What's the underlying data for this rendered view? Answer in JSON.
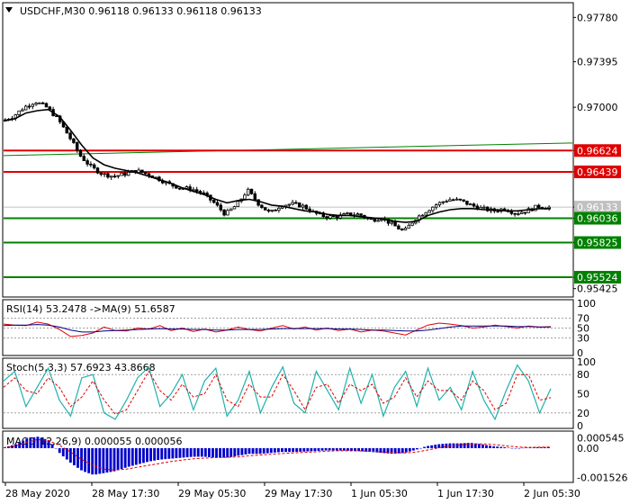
{
  "chart_data": {
    "type": "candlestick",
    "main": {
      "title": "USDCHF,M30  0.96118 0.96133 0.96118 0.96133",
      "ylim": [
        0.9536,
        0.979
      ],
      "y_ticks": [
        0.9778,
        0.97395,
        0.97,
        0.96624,
        0.96439,
        0.96133,
        0.96036,
        0.95825,
        0.95524,
        0.95425
      ],
      "x_labels": [
        "28 May 2020",
        "28 May 17:30",
        "29 May 05:30",
        "29 May 17:30",
        "1 Jun 05:30",
        "1 Jun 17:30",
        "2 Jun 05:30"
      ],
      "current_price": 0.96133,
      "levels": [
        {
          "value": 0.96624,
          "label": "0.96624",
          "color": "#e00000"
        },
        {
          "value": 0.96439,
          "label": "0.96439",
          "color": "#e00000"
        },
        {
          "value": 0.96036,
          "label": "0.96036",
          "color": "#008000"
        },
        {
          "value": 0.95825,
          "label": "0.95825",
          "color": "#008000"
        },
        {
          "value": 0.95524,
          "label": "0.95524",
          "color": "#008000"
        }
      ],
      "trendline": {
        "from": [
          0,
          0.9658
        ],
        "to": [
          156,
          0.9669
        ],
        "color": "#008000"
      },
      "price_path": [
        0.9688,
        0.9692,
        0.97,
        0.9705,
        0.97,
        0.969,
        0.9675,
        0.9658,
        0.9648,
        0.9642,
        0.964,
        0.9642,
        0.9645,
        0.9642,
        0.9638,
        0.9633,
        0.963,
        0.9629,
        0.9625,
        0.9617,
        0.9607,
        0.9615,
        0.9628,
        0.9616,
        0.9608,
        0.9615,
        0.9616,
        0.9614,
        0.9608,
        0.9605,
        0.9605,
        0.9607,
        0.9607,
        0.9602,
        0.9604,
        0.9598,
        0.9592,
        0.9603,
        0.961,
        0.9616,
        0.962,
        0.9619,
        0.9615,
        0.9612,
        0.961,
        0.9612,
        0.9608,
        0.961,
        0.9614,
        0.9613
      ],
      "ma_path": [
        0.9688,
        0.969,
        0.9695,
        0.9697,
        0.9698,
        0.9692,
        0.968,
        0.9667,
        0.9656,
        0.965,
        0.9647,
        0.9645,
        0.9643,
        0.964,
        0.9637,
        0.9634,
        0.963,
        0.9627,
        0.9624,
        0.962,
        0.9617,
        0.9619,
        0.962,
        0.9618,
        0.9615,
        0.9614,
        0.9612,
        0.961,
        0.9609,
        0.9607,
        0.9606,
        0.9606,
        0.9605,
        0.9604,
        0.9603,
        0.9601,
        0.96,
        0.9601,
        0.9606,
        0.9609,
        0.9611,
        0.9612,
        0.9612,
        0.9611,
        0.9611,
        0.961,
        0.961,
        0.9611,
        0.9612,
        0.9612
      ]
    },
    "rsi": {
      "title": "RSI(14) 53.2478  ->MA(9) 51.6587",
      "ylim": [
        0,
        100
      ],
      "y_ticks": [
        100,
        70,
        50,
        30,
        0
      ],
      "levels": [
        70,
        50,
        30
      ],
      "rsi_path": [
        58,
        56,
        55,
        62,
        58,
        47,
        33,
        35,
        40,
        52,
        45,
        44,
        50,
        48,
        55,
        45,
        50,
        43,
        48,
        42,
        46,
        52,
        47,
        44,
        50,
        55,
        48,
        52,
        46,
        50,
        45,
        48,
        42,
        46,
        44,
        40,
        36,
        46,
        56,
        60,
        58,
        55,
        50,
        52,
        56,
        53,
        50,
        54,
        52,
        53
      ],
      "ma_path": [
        55,
        56,
        56,
        57,
        56,
        52,
        46,
        42,
        42,
        44,
        45,
        46,
        47,
        48,
        49,
        48,
        48,
        47,
        47,
        46,
        46,
        47,
        47,
        47,
        48,
        49,
        49,
        49,
        49,
        49,
        48,
        48,
        47,
        46,
        46,
        45,
        44,
        44,
        46,
        49,
        52,
        54,
        54,
        54,
        54,
        54,
        53,
        53,
        52,
        52
      ]
    },
    "stoch": {
      "title": "Stoch(5,3,3) 57.6923 43.8668",
      "ylim": [
        0,
        100
      ],
      "y_ticks": [
        100,
        80,
        50,
        20,
        0
      ],
      "levels": [
        80,
        20
      ],
      "main_path": [
        70,
        85,
        30,
        60,
        90,
        40,
        15,
        75,
        80,
        20,
        10,
        40,
        75,
        92,
        30,
        50,
        80,
        25,
        70,
        90,
        15,
        40,
        85,
        20,
        60,
        92,
        35,
        20,
        85,
        55,
        25,
        90,
        35,
        80,
        15,
        60,
        85,
        30,
        90,
        40,
        60,
        25,
        85,
        40,
        10,
        55,
        95,
        70,
        20,
        58
      ],
      "signal_path": [
        60,
        75,
        55,
        50,
        75,
        60,
        30,
        45,
        70,
        40,
        18,
        25,
        55,
        85,
        55,
        40,
        65,
        45,
        50,
        80,
        40,
        30,
        65,
        45,
        45,
        80,
        55,
        25,
        60,
        65,
        35,
        65,
        55,
        65,
        35,
        45,
        75,
        45,
        70,
        55,
        55,
        40,
        70,
        55,
        25,
        35,
        80,
        80,
        40,
        44
      ]
    },
    "macd": {
      "title": "MACD(12,26,9) 0.000055 0.000056",
      "ylim": [
        -0.0017,
        0.00075
      ],
      "y_ticks": [
        0.000545,
        0.0,
        -0.001526
      ],
      "y_tick_labels": [
        "0.000545",
        "0.00",
        "-0.001526"
      ],
      "histogram": [
        5e-05,
        0.0002,
        0.0005,
        0.0006,
        0.0004,
        -0.0003,
        -0.0008,
        -0.0012,
        -0.0014,
        -0.0013,
        -0.0012,
        -0.001,
        -0.00085,
        -0.0007,
        -0.0006,
        -0.00055,
        -0.0005,
        -0.00045,
        -0.00045,
        -0.0005,
        -0.0005,
        -0.0004,
        -0.0003,
        -0.0003,
        -0.00025,
        -0.0002,
        -0.0002,
        -0.00018,
        -0.00015,
        -0.00012,
        -0.00012,
        -0.00014,
        -0.00016,
        -0.0002,
        -0.00025,
        -0.0003,
        -0.00025,
        -0.0001,
        0.0001,
        0.0002,
        0.00025,
        0.00025,
        0.00028,
        0.0002,
        0.0001,
        5e-05,
        -2e-05,
        3e-05,
        5e-05,
        5e-05
      ],
      "signal_path": [
        2e-05,
        0.0001,
        0.0003,
        0.00045,
        0.0004,
        0.00015,
        -0.0002,
        -0.0006,
        -0.0009,
        -0.0011,
        -0.00115,
        -0.0011,
        -0.001,
        -0.0009,
        -0.0008,
        -0.0007,
        -0.00062,
        -0.00056,
        -0.00052,
        -0.0005,
        -0.00048,
        -0.00046,
        -0.0004,
        -0.00036,
        -0.00032,
        -0.00028,
        -0.00025,
        -0.00022,
        -0.00019,
        -0.00016,
        -0.00014,
        -0.00014,
        -0.00015,
        -0.00017,
        -0.0002,
        -0.00024,
        -0.00025,
        -0.0002,
        -0.0001,
        2e-05,
        0.00012,
        0.00018,
        0.00022,
        0.00022,
        0.00018,
        0.00012,
        6e-05,
        4e-05,
        5e-05,
        6e-05
      ]
    },
    "colors": {
      "bull": "#000000",
      "bear": "#000000",
      "ma_main": "#000000",
      "rsi": "#00008b",
      "rsi_ma": "#e00000",
      "stoch_main": "#20b2aa",
      "stoch_signal": "#e00000",
      "macd_hist": "#0000cc",
      "macd_signal": "#e00000",
      "levels_dotted": "#a0a0a0",
      "price_tag": "#c0c0c0"
    }
  }
}
